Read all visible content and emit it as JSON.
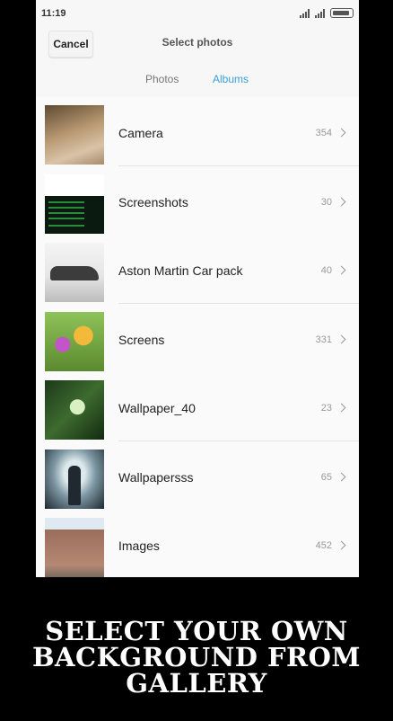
{
  "status_bar": {
    "time": "11:19"
  },
  "header": {
    "cancel_label": "Cancel",
    "title": "Select photos"
  },
  "tabs": [
    {
      "label": "Photos"
    },
    {
      "label": "Albums"
    }
  ],
  "albums": [
    {
      "name": "Camera",
      "count": "354"
    },
    {
      "name": "Screenshots",
      "count": "30"
    },
    {
      "name": "Aston Martin Car pack",
      "count": "40"
    },
    {
      "name": "Screens",
      "count": "331"
    },
    {
      "name": "Wallpaper_40",
      "count": "23"
    },
    {
      "name": "Wallpapersss",
      "count": "65"
    },
    {
      "name": "Images",
      "count": "452"
    }
  ],
  "caption": {
    "line1": "SELECT YOUR OWN",
    "line2": "BACKGROUND FROM",
    "line3": "GALLERY"
  },
  "colors": {
    "accent": "#3ba0d8",
    "background": "#000000"
  }
}
